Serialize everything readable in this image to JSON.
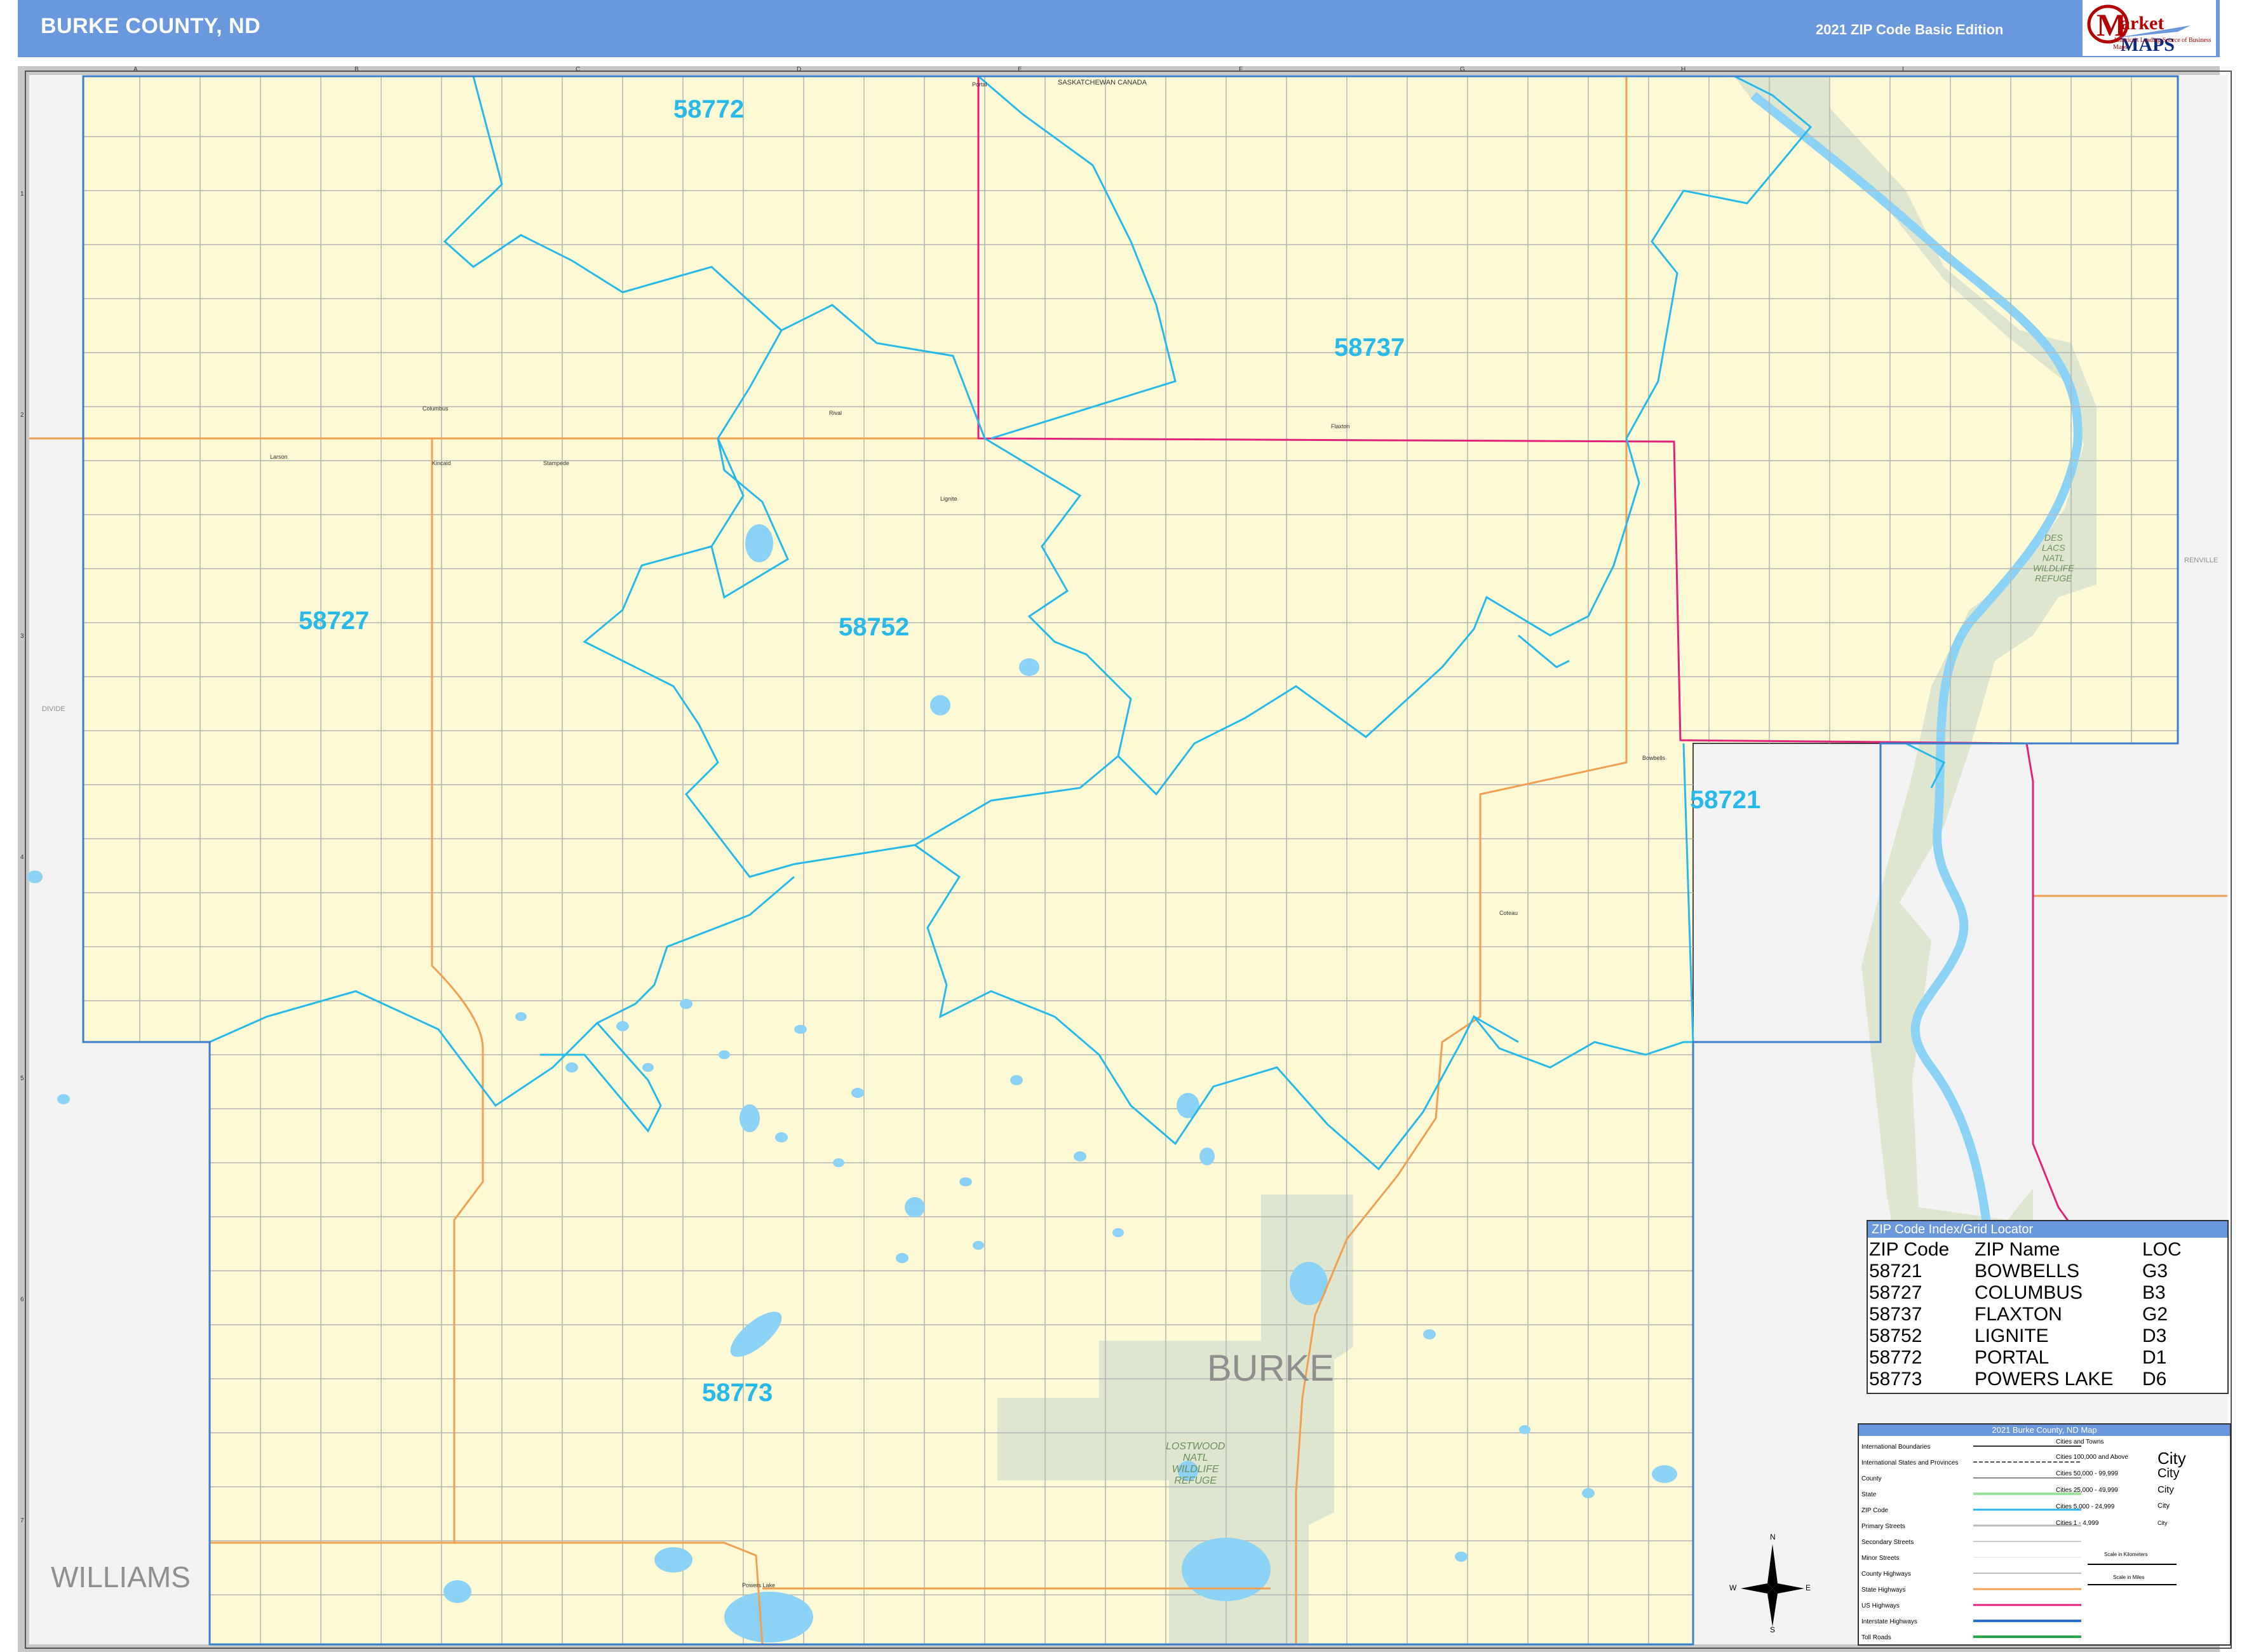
{
  "header": {
    "title": "BURKE COUNTY, ND",
    "edition": "2021 ZIP Code Basic Edition",
    "logo_word1": "arket",
    "logo_word2": "MAPS",
    "logo_tagline": "America's Leading Source of Business Maps"
  },
  "map": {
    "county_label": "BURKE",
    "neighbors": {
      "williams": "WILLIAMS",
      "divide": "DIVIDE",
      "renville": "RENVILLE"
    },
    "canada_label": "SASKATCHEWAN  CANADA",
    "zip_labels": [
      "58772",
      "58737",
      "58727",
      "58752",
      "58721",
      "58773"
    ],
    "places": [
      "Columbus",
      "Larson",
      "Kincaid",
      "Stampede",
      "Rival",
      "Lignite",
      "Flaxton",
      "Bowbells",
      "Coteau",
      "Powers Lake",
      "Portal"
    ],
    "refuges": {
      "des_lacs": [
        "DES",
        "LACS",
        "NATL",
        "WILDLIFE",
        "REFUGE"
      ],
      "lostwood": [
        "LOSTWOOD",
        "NATL",
        "WILDLIFE",
        "REFUGE"
      ]
    },
    "grid_columns": [
      "A",
      "B",
      "C",
      "D",
      "E",
      "F",
      "G",
      "H",
      "I"
    ],
    "grid_rows": [
      "1",
      "2",
      "3",
      "4",
      "5",
      "6",
      "7"
    ],
    "colors": {
      "county_fill": "#fdf9d4",
      "outside_fill": "#f2f2f2",
      "zip_boundary": "#27b9ea",
      "water": "#8cd2f5",
      "refuge": "#dfe6cf",
      "us_highway": "#e0227a",
      "state_highway": "#f0a050",
      "grid_roads": "#b4b4b4"
    }
  },
  "zip_index": {
    "heading": "ZIP Code Index/Grid Locator",
    "columns": [
      "ZIP Code",
      "ZIP Name",
      "LOC"
    ],
    "rows": [
      [
        "58721",
        "BOWBELLS",
        "G3"
      ],
      [
        "58727",
        "COLUMBUS",
        "B3"
      ],
      [
        "58737",
        "FLAXTON",
        "G2"
      ],
      [
        "58752",
        "LIGNITE",
        "D3"
      ],
      [
        "58772",
        "PORTAL",
        "D1"
      ],
      [
        "58773",
        "POWERS LAKE",
        "D6"
      ]
    ]
  },
  "legend": {
    "heading": "2021 Burke County, ND Map",
    "left_items": [
      "International Boundaries",
      "International States and Provinces",
      "County",
      "State",
      "ZIP Code",
      "Primary Streets",
      "Secondary Streets",
      "Minor Streets",
      "County Highways",
      "State Highways",
      "US Highways",
      "Interstate Highways",
      "Toll Roads"
    ],
    "right_items": [
      [
        "Cities and Towns",
        ""
      ],
      [
        "Cities 100,000 and Above",
        "City"
      ],
      [
        "Cities 50,000 - 99,999",
        "City"
      ],
      [
        "Cities 25,000 - 49,999",
        "City"
      ],
      [
        "Cities 5,000 - 24,999",
        "City"
      ],
      [
        "Cities 1 - 4,999",
        "City"
      ]
    ],
    "scale_km": "Scale in Kilometers",
    "scale_mi": "Scale in Miles"
  },
  "compass": [
    "N",
    "S",
    "E",
    "W"
  ]
}
